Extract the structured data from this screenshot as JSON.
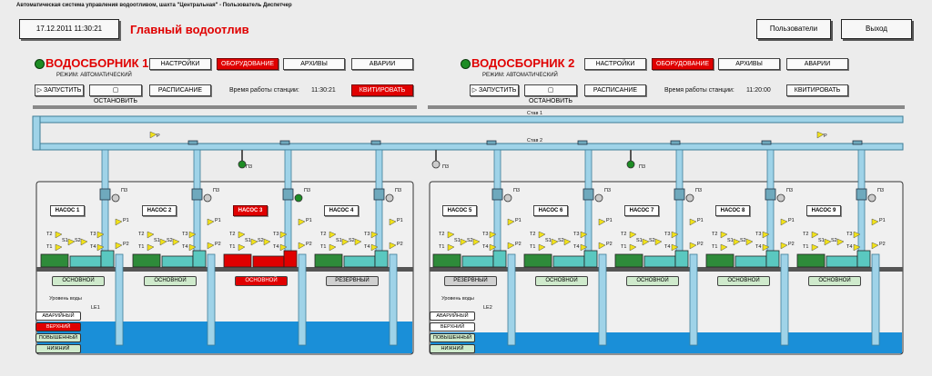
{
  "header": {
    "caption": "Автоматическая система управления водоотливом, шахта \"Центральная\" - Пользователь Диспетчер",
    "datetime": "17.12.2011   11:30:21",
    "title": "Главный водоотлив",
    "users_label": "Пользователи",
    "exit_label": "Выход"
  },
  "stations": [
    {
      "name": "ВОДОСБОРНИК 1",
      "mode": "РЕЖИМ: АВТОМАТИЧЕСКИЙ",
      "settings": "НАСТРОЙКИ",
      "equipment": "ОБОРУДОВАНИЕ",
      "archives": "АРХИВЫ",
      "alarms": "АВАРИИ",
      "start": "ЗАПУСТИТЬ",
      "stop": "ОСТАНОВИТЬ",
      "schedule": "РАСПИСАНИЕ",
      "uptime_label": "Время работы станции:",
      "uptime": "11:30:21",
      "ack": "КВИТИРОВАТЬ"
    },
    {
      "name": "ВОДОСБОРНИК 2",
      "mode": "РЕЖИМ: АВТОМАТИЧЕСКИЙ",
      "settings": "НАСТРОЙКИ",
      "equipment": "ОБОРУДОВАНИЕ",
      "archives": "АРХИВЫ",
      "alarms": "АВАРИИ",
      "start": "ЗАПУСТИТЬ",
      "stop": "ОСТАНОВИТЬ",
      "schedule": "РАСПИСАНИЕ",
      "uptime_label": "Время работы станции:",
      "uptime": "11:20:00",
      "ack": "КВИТИРОВАТЬ"
    }
  ],
  "pipes": {
    "stan1": "Став 1",
    "stan2": "Став 2",
    "p": "P",
    "p3": "П3"
  },
  "pumps": [
    {
      "name": "НАСОС 1",
      "mode": "ОСНОВНОЙ",
      "state": "normal"
    },
    {
      "name": "НАСОС 2",
      "mode": "ОСНОВНОЙ",
      "state": "normal"
    },
    {
      "name": "НАСОС 3",
      "mode": "ОСНОВНОЙ",
      "state": "alarm"
    },
    {
      "name": "НАСОС 4",
      "mode": "РЕЗЕРВНЫЙ",
      "state": "reserve"
    },
    {
      "name": "НАСОС 5",
      "mode": "РЕЗЕРВНЫЙ",
      "state": "reserve"
    },
    {
      "name": "НАСОС 6",
      "mode": "ОСНОВНОЙ",
      "state": "normal"
    },
    {
      "name": "НАСОС 7",
      "mode": "ОСНОВНОЙ",
      "state": "normal"
    },
    {
      "name": "НАСОС 8",
      "mode": "ОСНОВНОЙ",
      "state": "normal"
    },
    {
      "name": "НАСОС 9",
      "mode": "ОСНОВНОЙ",
      "state": "normal"
    }
  ],
  "sensors": {
    "p1": "P1",
    "p2": "P2",
    "t1": "T1",
    "t2": "T2",
    "t3": "T3",
    "t4": "T4",
    "s1": "S1",
    "s2": "S2",
    "p3": "П3"
  },
  "levels": {
    "title": "Уровень воды",
    "le1": "LE1",
    "le2": "LE2",
    "items": [
      "АВАРИЙНЫЙ",
      "ВЕРХНИЙ",
      "ПОВЫШЕННЫЙ",
      "НИЖНИЙ"
    ]
  },
  "colors": {
    "alarm": "#e00000",
    "water": "#1a8fd8",
    "pipe": "#9fd3e8",
    "pump": "#2e8b3a",
    "pumpbody": "#5ac8c0"
  }
}
